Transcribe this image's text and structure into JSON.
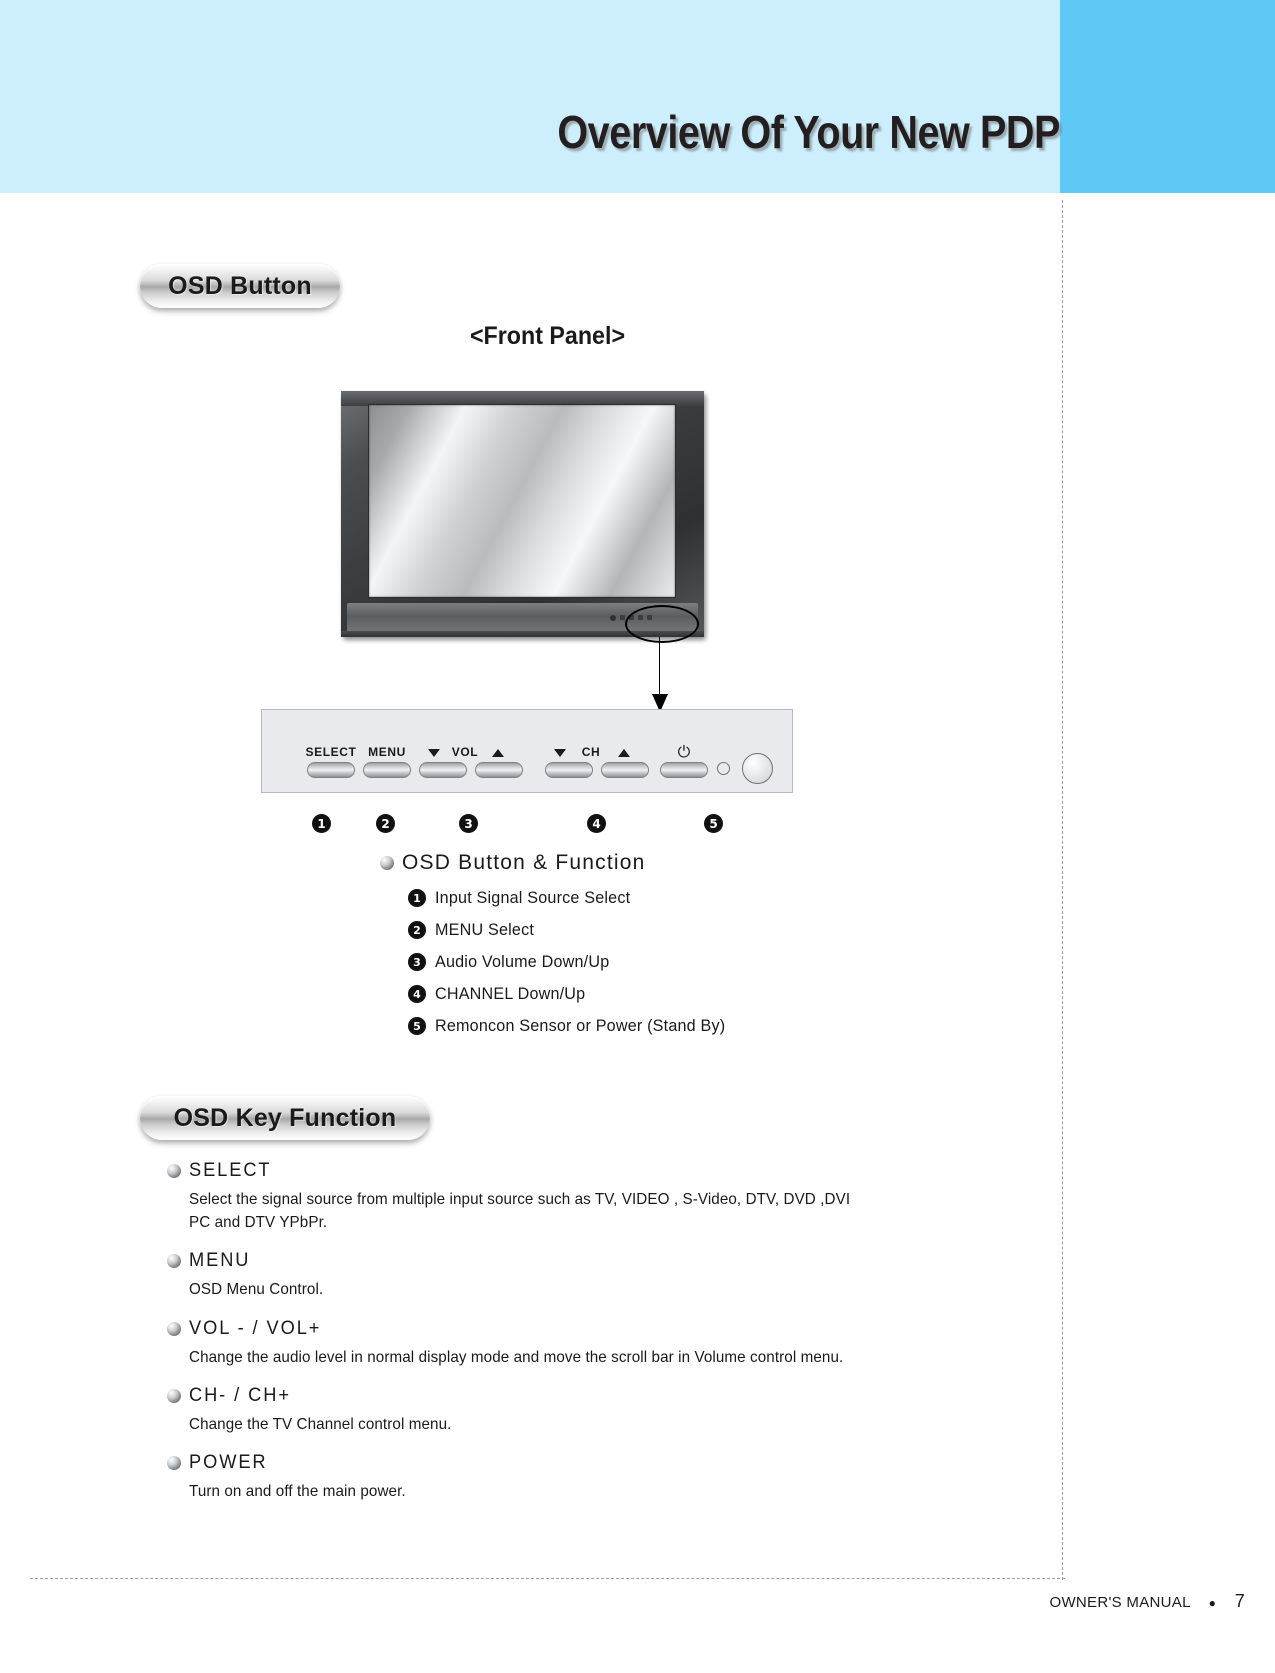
{
  "header": {
    "title": "Overview Of Your New PDP",
    "band_color": "#cdeefc",
    "accent_color": "#5dc9f4"
  },
  "sections": {
    "osd_button_badge": "OSD Button",
    "osd_key_badge": "OSD Key Function",
    "front_panel_label": "<Front Panel>"
  },
  "control_panel": {
    "keys": [
      {
        "label": "SELECT",
        "glyph": ""
      },
      {
        "label": "MENU",
        "glyph": ""
      },
      {
        "label": "VOL",
        "glyph": "down"
      },
      {
        "label": "",
        "glyph": "up"
      },
      {
        "label": "CH",
        "glyph": "down"
      },
      {
        "label": "",
        "glyph": "up"
      },
      {
        "label": "",
        "glyph": "power"
      }
    ],
    "power_symbol": "⏻",
    "markers": [
      "1",
      "2",
      "3",
      "4",
      "5"
    ]
  },
  "osd_function": {
    "heading": "OSD Button & Function",
    "items": [
      {
        "num": "1",
        "text": "Input Signal Source Select"
      },
      {
        "num": "2",
        "text": "MENU Select"
      },
      {
        "num": "3",
        "text": "Audio Volume Down/Up"
      },
      {
        "num": "4",
        "text": "CHANNEL Down/Up"
      },
      {
        "num": "5",
        "text": "Remoncon Sensor or Power (Stand By)"
      }
    ]
  },
  "key_functions": [
    {
      "title": "SELECT",
      "lines": [
        "Select the signal source from multiple input source such as TV, VIDEO , S-Video, DTV, DVD ,DVI",
        "PC and DTV YPbPr."
      ]
    },
    {
      "title": "MENU",
      "lines": [
        "OSD Menu Control."
      ]
    },
    {
      "title": "VOL - / VOL+",
      "lines": [
        "Change the audio level in normal display mode and  move the scroll bar in Volume control menu."
      ]
    },
    {
      "title": "CH- / CH+",
      "lines": [
        "Change the TV Channel control menu."
      ]
    },
    {
      "title": "POWER",
      "lines": [
        "Turn on and off the main power."
      ]
    }
  ],
  "footer": {
    "manual_label": "OWNER'S MANUAL",
    "dot": "●",
    "page_number": "7"
  }
}
